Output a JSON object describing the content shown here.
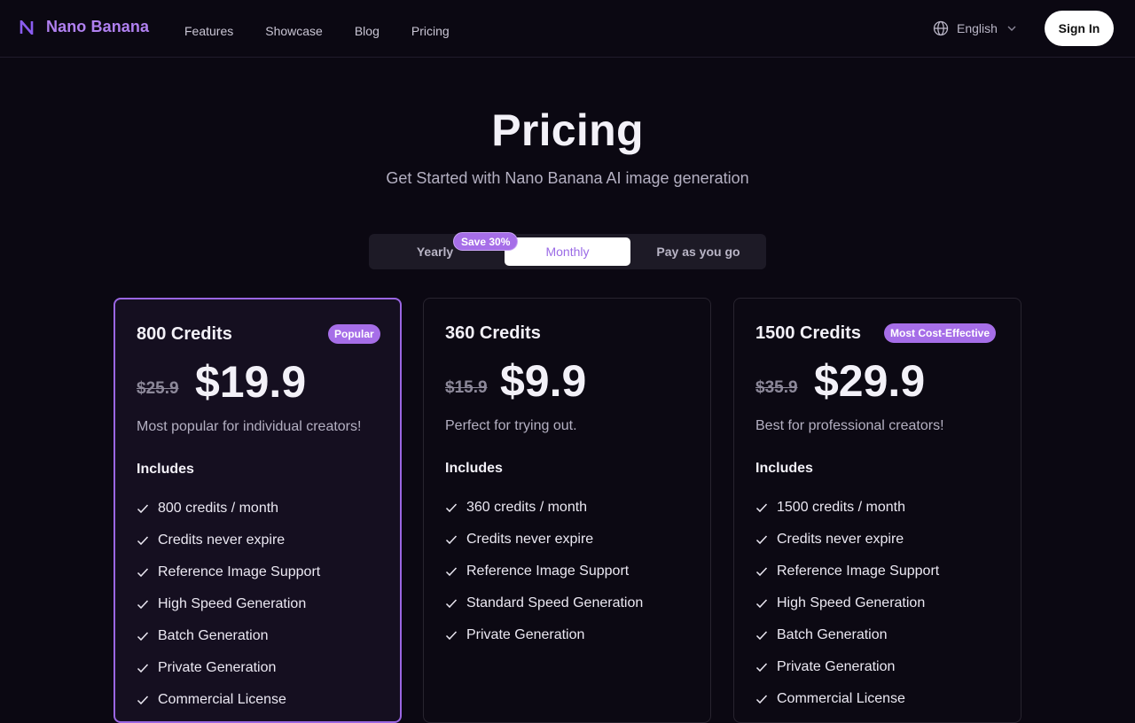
{
  "header": {
    "brand": "Nano Banana",
    "nav": [
      "Features",
      "Showcase",
      "Blog",
      "Pricing"
    ],
    "language": "English",
    "sign_in": "Sign In"
  },
  "hero": {
    "title": "Pricing",
    "subtitle": "Get Started with Nano Banana AI image generation"
  },
  "billing_toggle": {
    "options": [
      "Yearly",
      "Monthly",
      "Pay as you go"
    ],
    "selected": "Monthly",
    "save_badge": "Save 30%"
  },
  "plans": [
    {
      "title": "800 Credits",
      "badge": "Popular",
      "old_price": "$25.9",
      "price": "$19.9",
      "description": "Most popular for individual creators!",
      "includes_label": "Includes",
      "features": [
        "800 credits / month",
        "Credits never expire",
        "Reference Image Support",
        "High Speed Generation",
        "Batch Generation",
        "Private Generation",
        "Commercial License"
      ]
    },
    {
      "title": "360 Credits",
      "badge": "",
      "old_price": "$15.9",
      "price": "$9.9",
      "description": "Perfect for trying out.",
      "includes_label": "Includes",
      "features": [
        "360 credits / month",
        "Credits never expire",
        "Reference Image Support",
        "Standard Speed Generation",
        "Private Generation"
      ]
    },
    {
      "title": "1500 Credits",
      "badge": "Most Cost-Effective",
      "old_price": "$35.9",
      "price": "$29.9",
      "description": "Best for professional creators!",
      "includes_label": "Includes",
      "features": [
        "1500 credits / month",
        "Credits never expire",
        "Reference Image Support",
        "High Speed Generation",
        "Batch Generation",
        "Private Generation",
        "Commercial License"
      ]
    }
  ],
  "colors": {
    "accent": "#a66ee8",
    "background": "#0b0812"
  }
}
